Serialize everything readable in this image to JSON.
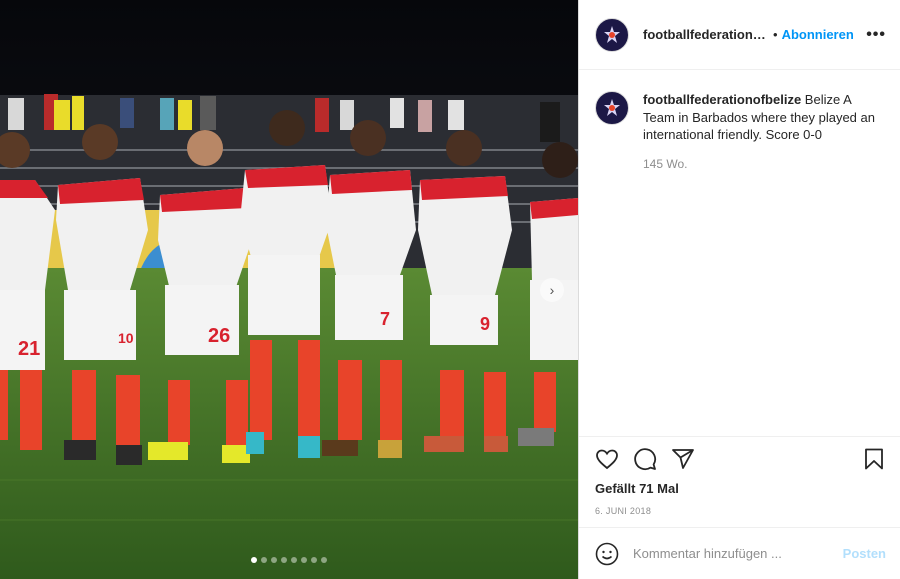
{
  "post": {
    "username": "footballfederationofbelize",
    "follow_label": "Abonnieren",
    "header_separator": "•",
    "more_label": "•••",
    "caption": "Belize A Team in Barbados where they played an international friendly. Score 0-0",
    "caption_age": "145 Wo.",
    "likes": "Gefällt 71 Mal",
    "date": "6. JUNI 2018"
  },
  "photo": {
    "jersey_numbers": [
      "21",
      "10",
      "26",
      "",
      "7",
      "9",
      ""
    ],
    "carousel_total": 8,
    "carousel_active": 1
  },
  "comment": {
    "placeholder": "Kommentar hinzufügen ...",
    "post_label": "Posten"
  },
  "icons": [
    "heart-icon",
    "comment-icon",
    "share-icon",
    "bookmark-icon",
    "emoji-icon",
    "more-icon",
    "chevron-right-icon"
  ],
  "colors": {
    "follow_blue": "#0095f6",
    "post_disabled": "#b2dffc",
    "jersey_red": "#d8222e",
    "pitch_green": "#4b7a2a"
  }
}
